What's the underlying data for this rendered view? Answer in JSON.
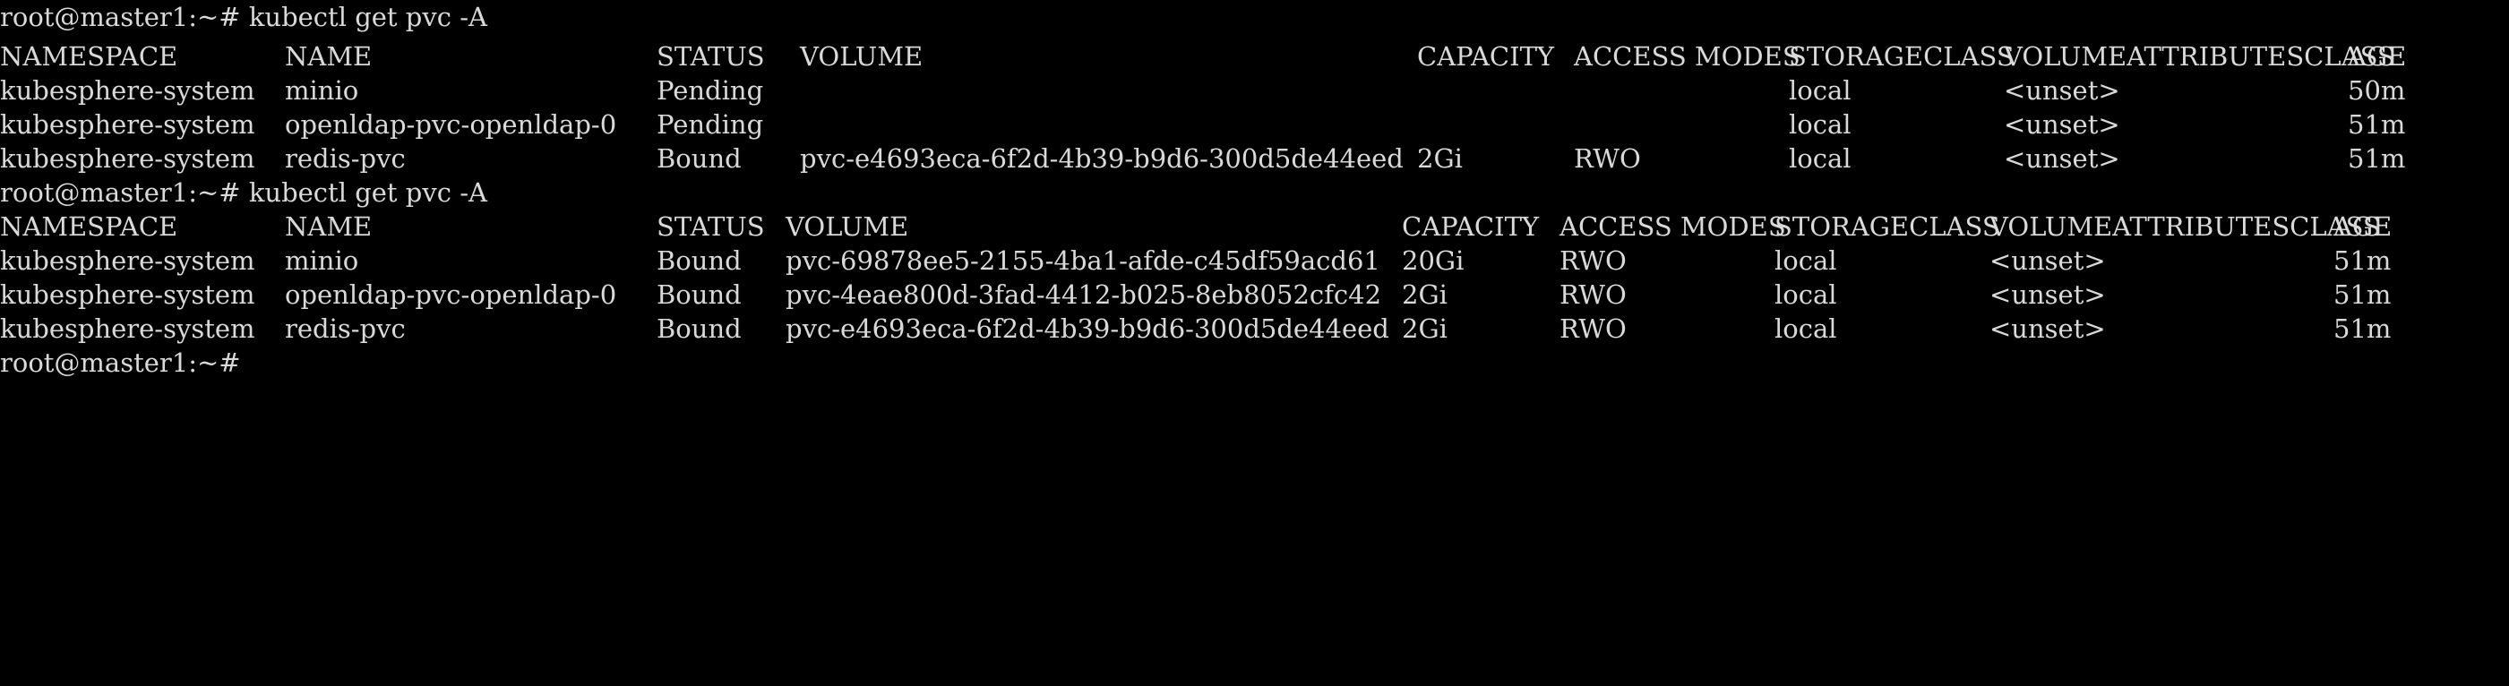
{
  "prompt": "root@master1:~#",
  "command": "kubectl get pvc -A",
  "table1": {
    "headers": [
      "NAMESPACE",
      "NAME",
      "STATUS",
      "VOLUME",
      "CAPACITY",
      "ACCESS MODES",
      "STORAGECLASS",
      "VOLUMEATTRIBUTESCLASS",
      "AGE"
    ],
    "rows": [
      [
        "kubesphere-system",
        "minio",
        "Pending",
        "",
        "",
        "",
        "local",
        "<unset>",
        "50m"
      ],
      [
        "kubesphere-system",
        "openldap-pvc-openldap-0",
        "Pending",
        "",
        "",
        "",
        "local",
        "<unset>",
        "51m"
      ],
      [
        "kubesphere-system",
        "redis-pvc",
        "Bound",
        "pvc-e4693eca-6f2d-4b39-b9d6-300d5de44eed",
        "2Gi",
        "RWO",
        "local",
        "<unset>",
        "51m"
      ]
    ]
  },
  "table2": {
    "headers": [
      "NAMESPACE",
      "NAME",
      "STATUS",
      "VOLUME",
      "CAPACITY",
      "ACCESS MODES",
      "STORAGECLASS",
      "VOLUMEATTRIBUTESCLASS",
      "AGE"
    ],
    "rows": [
      [
        "kubesphere-system",
        "minio",
        "Bound",
        "pvc-69878ee5-2155-4ba1-afde-c45df59acd61",
        "20Gi",
        "RWO",
        "local",
        "<unset>",
        "51m"
      ],
      [
        "kubesphere-system",
        "openldap-pvc-openldap-0",
        "Bound",
        "pvc-4eae800d-3fad-4412-b025-8eb8052cfc42",
        "2Gi",
        "RWO",
        "local",
        "<unset>",
        "51m"
      ],
      [
        "kubesphere-system",
        "redis-pvc",
        "Bound",
        "pvc-e4693eca-6f2d-4b39-b9d6-300d5de44eed",
        "2Gi",
        "RWO",
        "local",
        "<unset>",
        "51m"
      ]
    ]
  },
  "colors": {
    "background": "#000000",
    "text": "#d9d9d9"
  }
}
